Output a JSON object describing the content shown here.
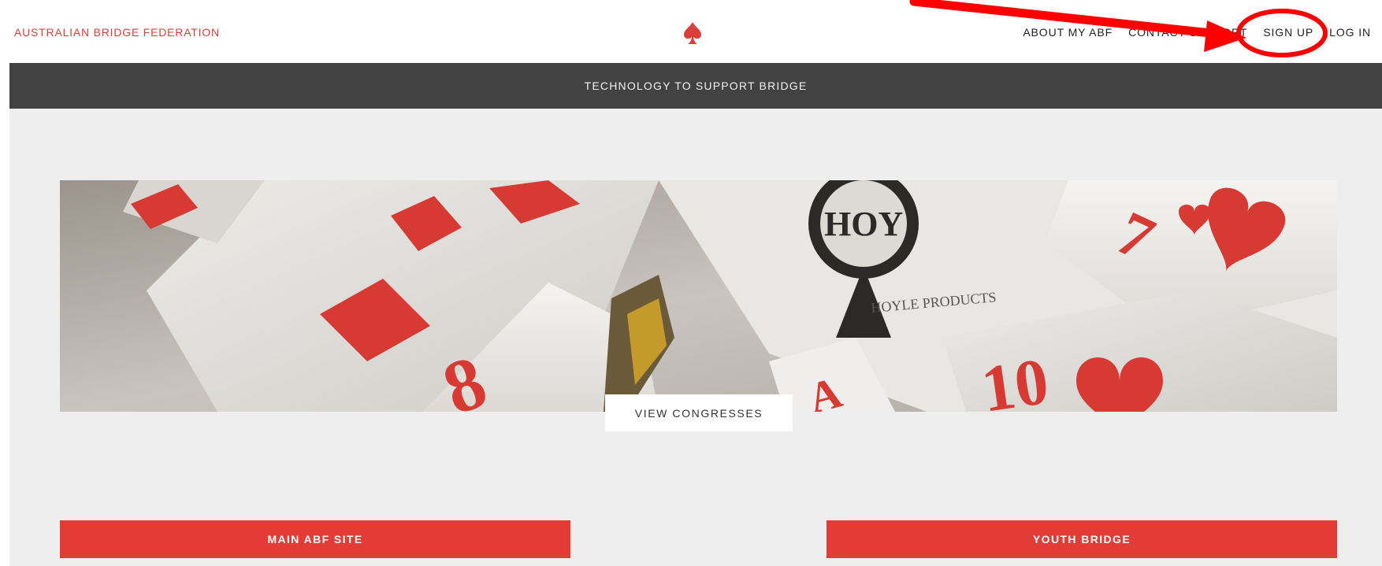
{
  "header": {
    "brand": "AUSTRALIAN BRIDGE FEDERATION",
    "nav": [
      {
        "label": "ABOUT MY ABF"
      },
      {
        "label": "CONTACT SUPPORT"
      },
      {
        "label": "SIGN UP"
      },
      {
        "label": "LOG IN"
      }
    ]
  },
  "band": {
    "text": "TECHNOLOGY TO SUPPORT BRIDGE"
  },
  "hero": {
    "cta_label": "VIEW CONGRESSES"
  },
  "buttons": {
    "left_label": "MAIN ABF SITE",
    "right_label": "YOUTH BRIDGE"
  },
  "colors": {
    "brand_red": "#d9403a",
    "button_red": "#e33b35",
    "band_dark": "#424242",
    "page_gray": "#eeeeee",
    "annotation_red": "#ff0000"
  },
  "icons": {
    "logo": "spade-icon"
  }
}
